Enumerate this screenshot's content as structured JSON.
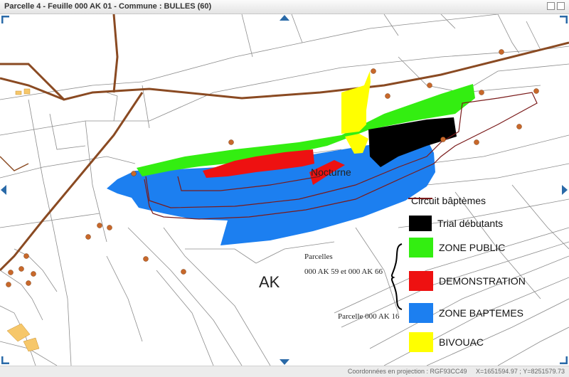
{
  "window": {
    "title": "Parcelle 4 - Feuille 000 AK 01 - Commune : BULLES (60)"
  },
  "map_labels": {
    "nocturne": "Nocturne",
    "section": "AK",
    "parcelles_title": "Parcelles",
    "parcelles_ids": "000 AK 59 et 000 AK 66",
    "parcelle_16": "Parcelle 000 AK 16"
  },
  "legend": {
    "circuit": "Circuit bâptèmes",
    "trial": "Trial débutants",
    "zone_public": "ZONE PUBLIC",
    "demonstration": "DEMONSTRATION",
    "zone_baptemes": "ZONE BAPTEMES",
    "bivouac": "BIVOUAC"
  },
  "status": {
    "projection": "Coordonnées en projection : RGF93CC49",
    "x": "X=1651594.97",
    "y": "Y=8251579.73"
  },
  "colors": {
    "zone_public": "#33ee11",
    "demonstration": "#ee1111",
    "zone_baptemes": "#1c7ff0",
    "trial": "#000000",
    "bivouac": "#ffff00",
    "circuit": "#7a1a1a",
    "roads": "#8a4a22",
    "markers": "#c8682a",
    "nav_arrows": "#2a6aa8"
  }
}
